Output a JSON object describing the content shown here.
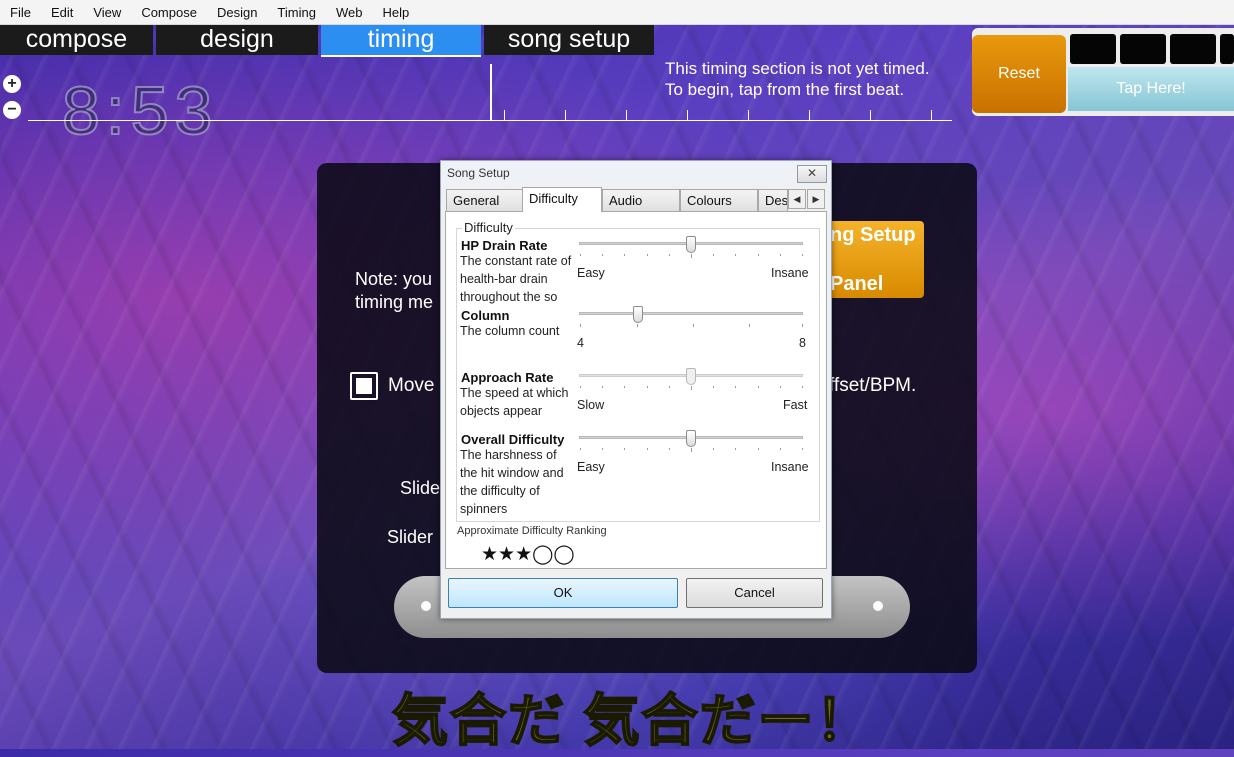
{
  "menu": [
    "File",
    "Edit",
    "View",
    "Compose",
    "Design",
    "Timing",
    "Web",
    "Help"
  ],
  "mode_tabs": [
    "compose",
    "design",
    "timing",
    "song setup"
  ],
  "timeline": {
    "time": "8:53",
    "zoom_in": "+",
    "zoom_out": "−",
    "message_line1": "This timing section is not yet timed.",
    "message_line2": "To begin, tap from the first beat."
  },
  "tapper": {
    "reset_label": "Reset",
    "tap_label": "Tap Here!"
  },
  "background_panel": {
    "note_line1": "Note: you",
    "note_line2": "timing me",
    "move_label": "Move",
    "offset_label": "ffset/BPM.",
    "slider_label_1": "Slide",
    "slider_label_2": "Slider",
    "song_setup_l1": "ng Setup",
    "song_setup_l2": "Panel"
  },
  "subtitle": "気合だ 気合だー！",
  "dialog": {
    "title": "Song Setup",
    "close": "✕",
    "tabs": [
      "General",
      "Difficulty",
      "Audio",
      "Colours",
      "Des"
    ],
    "active_tab": "Difficulty",
    "group_title": "Difficulty",
    "settings": [
      {
        "title": "HP Drain Rate",
        "desc": "The constant rate of health-bar drain throughout the so",
        "min_label": "Easy",
        "max_label": "Insane",
        "value": 0.5
      },
      {
        "title": "Column",
        "desc": "The column count",
        "min_label": "4",
        "max_label": "8",
        "value": 0.25
      },
      {
        "title": "Approach Rate",
        "desc": "The speed at which objects appear",
        "min_label": "Slow",
        "max_label": "Fast",
        "value": 0.5
      },
      {
        "title": "Overall Difficulty",
        "desc": "The harshness of the hit window and the difficulty of spinners",
        "min_label": "Easy",
        "max_label": "Insane",
        "value": 0.5
      }
    ],
    "ranking_label": "Approximate Difficulty Ranking",
    "ranking_stars": "★★★◯◯",
    "ok_label": "OK",
    "cancel_label": "Cancel"
  }
}
